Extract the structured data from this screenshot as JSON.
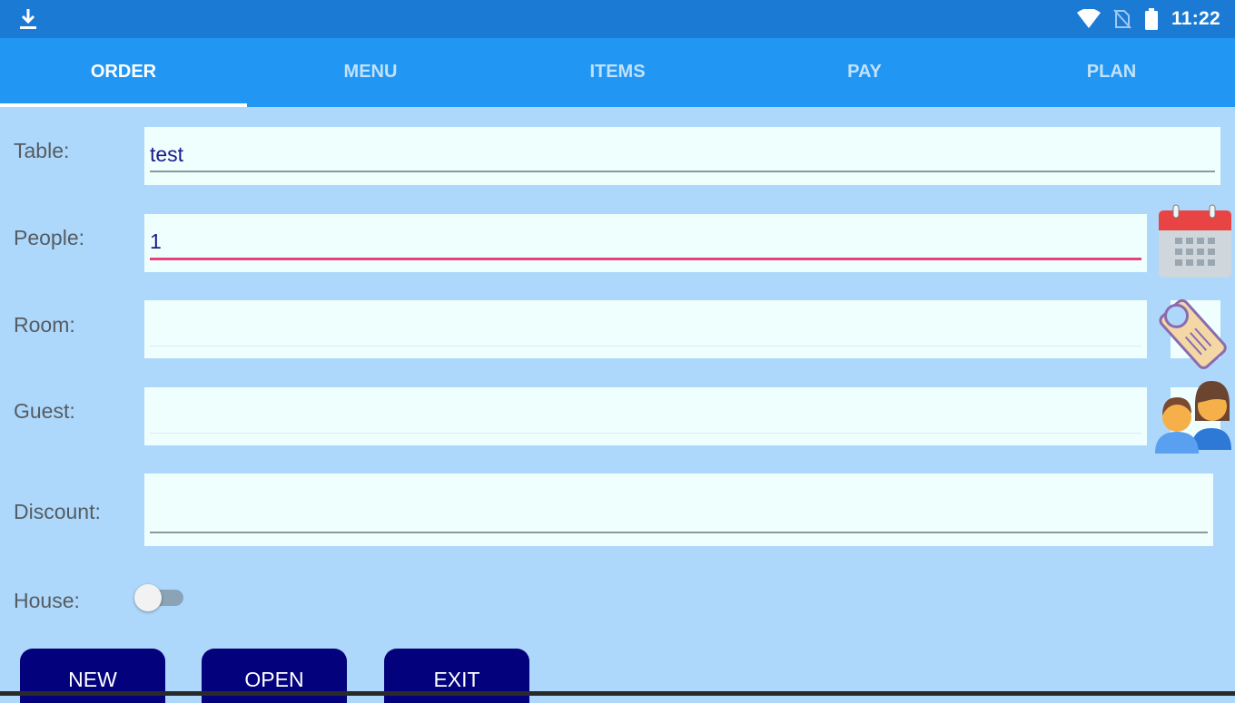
{
  "status_bar": {
    "time": "11:22",
    "icons": [
      "download-icon",
      "wifi-icon",
      "no-sim-icon",
      "battery-icon"
    ]
  },
  "tabs": [
    {
      "label": "ORDER",
      "active": true
    },
    {
      "label": "MENU",
      "active": false
    },
    {
      "label": "ITEMS",
      "active": false
    },
    {
      "label": "PAY",
      "active": false
    },
    {
      "label": "PLAN",
      "active": false
    }
  ],
  "form": {
    "table": {
      "label": "Table:",
      "value": "test"
    },
    "people": {
      "label": "People:",
      "value": "1"
    },
    "room": {
      "label": "Room:",
      "value": ""
    },
    "guest": {
      "label": "Guest:",
      "value": ""
    },
    "discount": {
      "label": "Discount:",
      "value": ""
    },
    "house": {
      "label": "House:",
      "checked": false
    }
  },
  "side_icons": [
    "calendar-icon",
    "door-hanger-icon",
    "guests-icon"
  ],
  "buttons": {
    "new": "NEW",
    "open": "OPEN",
    "exit": "EXIT"
  },
  "colors": {
    "status_bar": "#1a7ad4",
    "tab_bar": "#2196f3",
    "background": "#aed8fb",
    "field_bg": "#effffe",
    "focus_line": "#e9407a",
    "button": "#03027c"
  }
}
